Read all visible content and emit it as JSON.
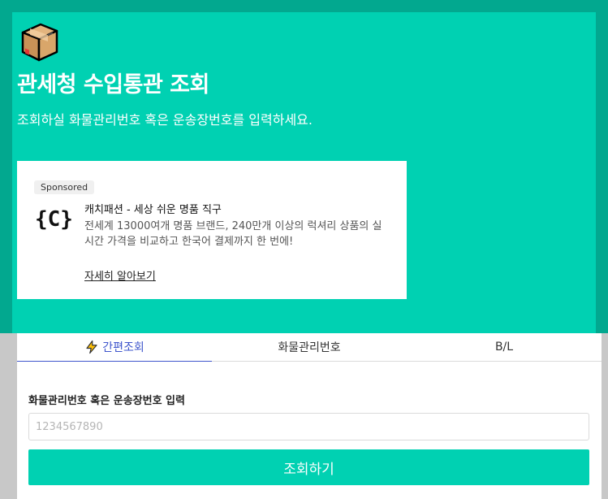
{
  "header": {
    "logo_icon": "package-box-icon",
    "title": "관세청 수입통관 조회",
    "subtitle": "조회하실 화물관리번호 혹은 운송장번호를 입력하세요."
  },
  "ad": {
    "badge": "Sponsored",
    "logo_text": "{C}",
    "title": "캐치패션 - 세상 쉬운 명품 직구",
    "description": "전세계 13000여개 명품 브랜드, 240만개 이상의 럭셔리 상품의 실시간 가격을 비교하고 한국어 결제까지 한 번에!",
    "link_label": "자세히 알아보기"
  },
  "tabs": [
    {
      "label": "간편조회",
      "icon": "lightning-bolt-icon",
      "active": true
    },
    {
      "label": "화물관리번호",
      "active": false
    },
    {
      "label": "B/L",
      "active": false
    }
  ],
  "form": {
    "field_label": "화물관리번호 혹은 운송장번호 입력",
    "placeholder": "1234567890",
    "value": "",
    "submit_label": "조회하기"
  },
  "colors": {
    "brand": "#00d1b2",
    "brand_dark": "#02a88f",
    "active_tab": "#3e55cc"
  }
}
